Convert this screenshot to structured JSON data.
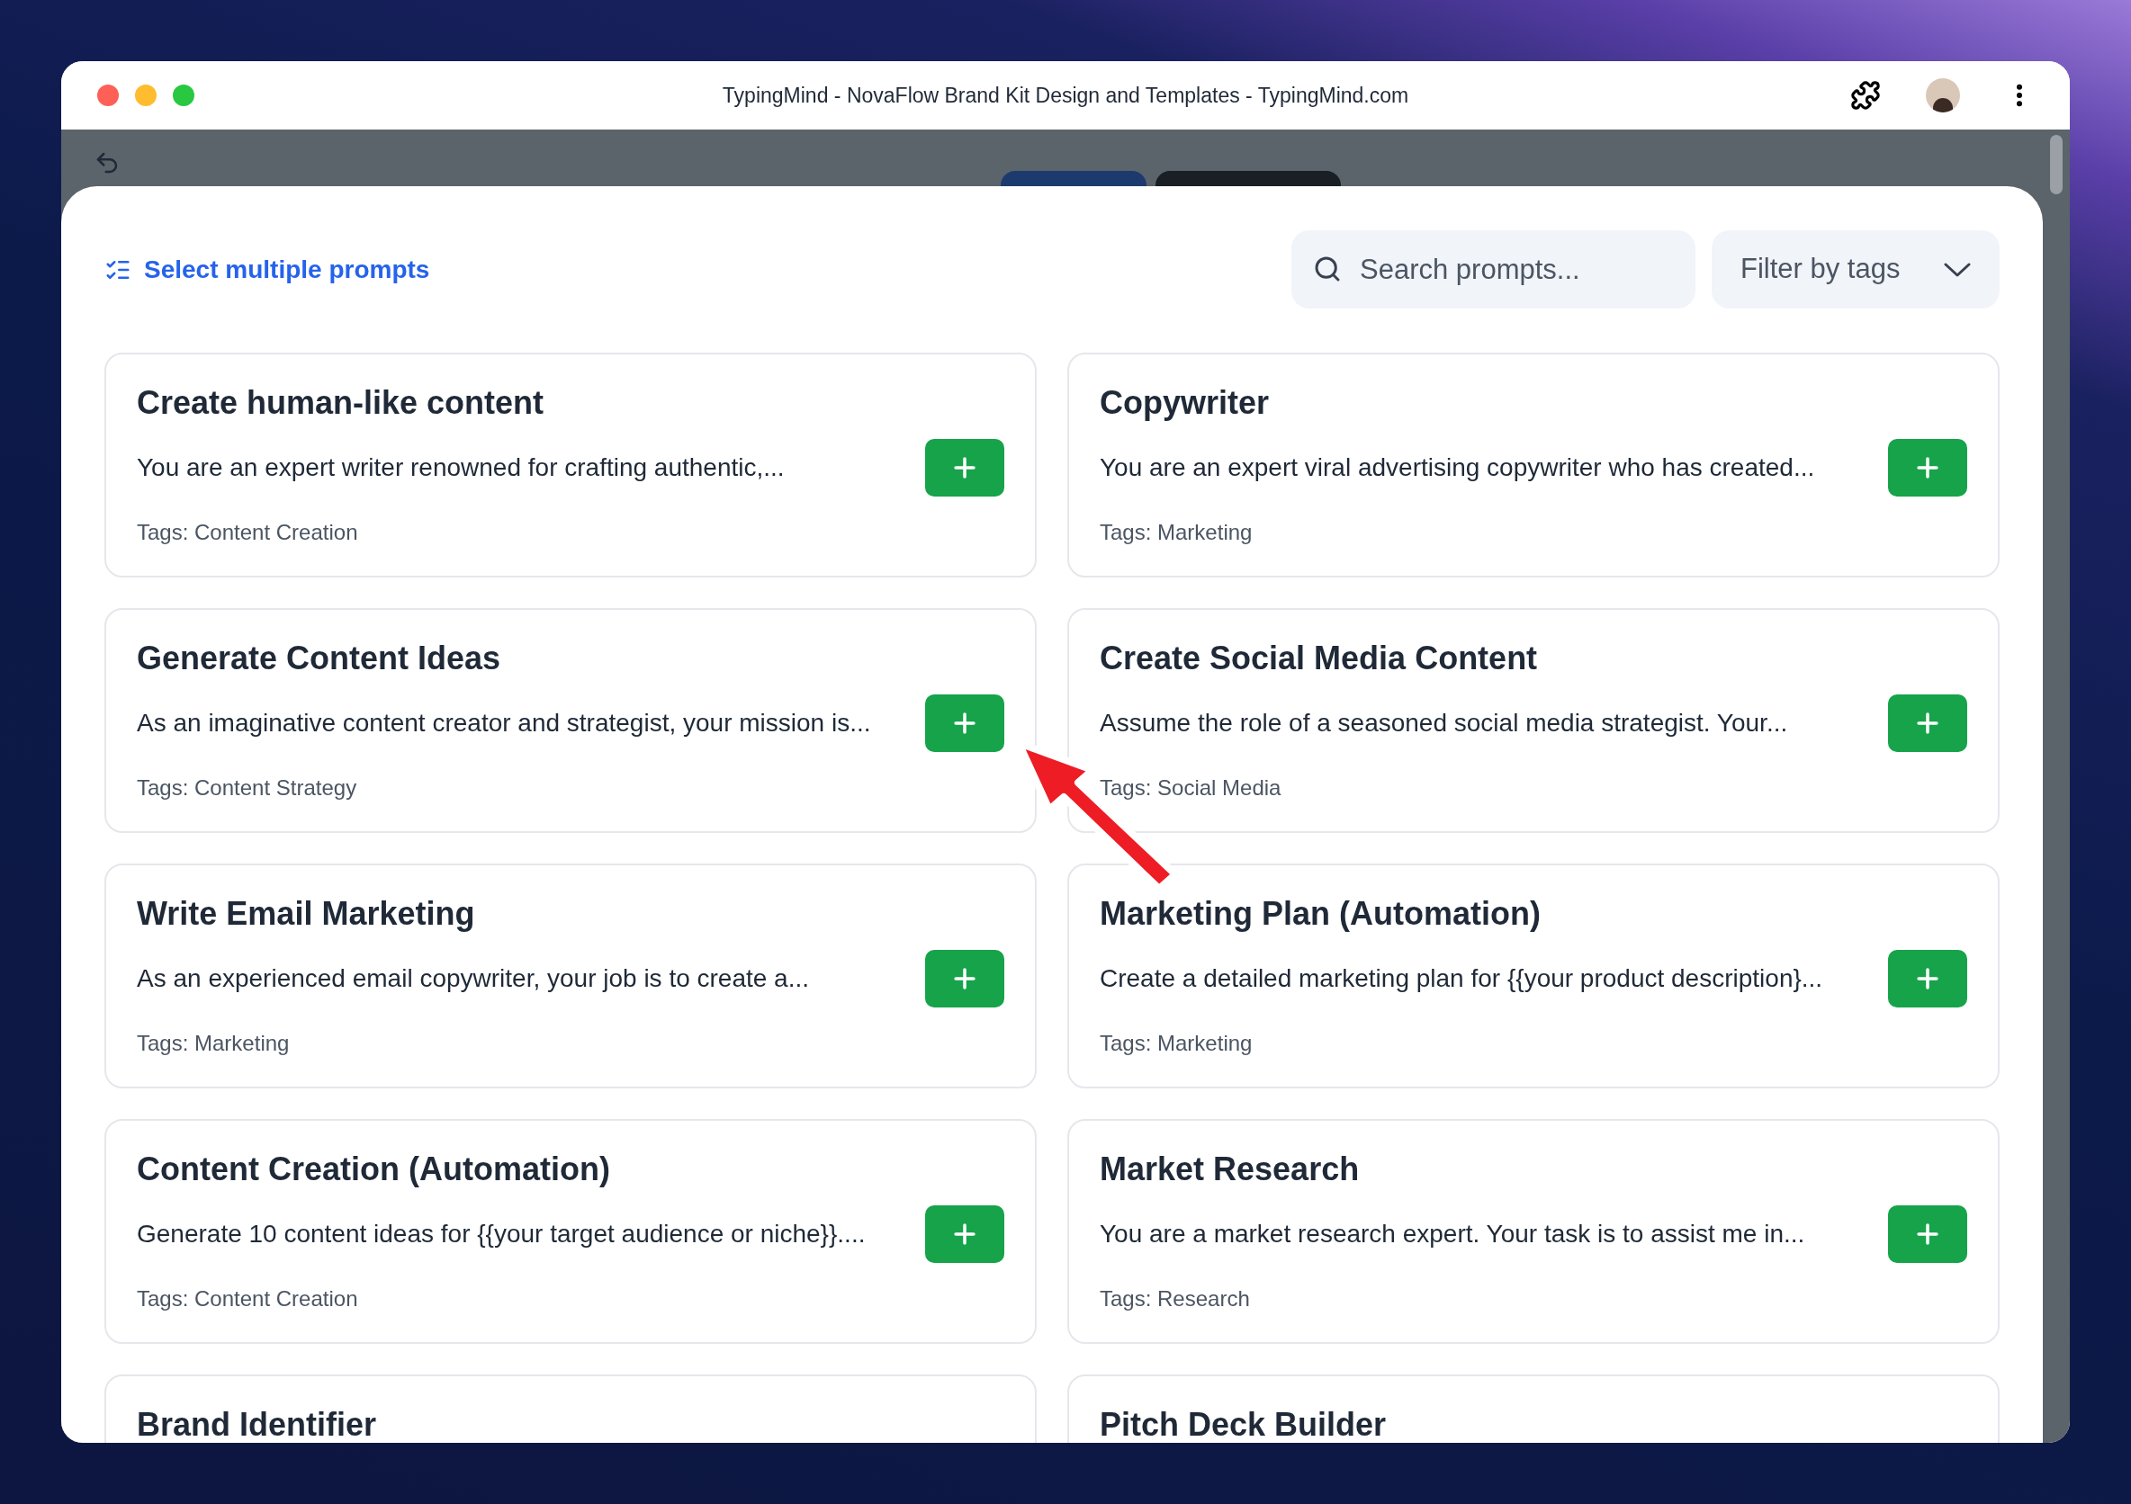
{
  "window": {
    "title": "TypingMind - NovaFlow Brand Kit Design and Templates - TypingMind.com"
  },
  "modal": {
    "select_link": "Select multiple prompts",
    "search": {
      "placeholder": "Search prompts..."
    },
    "filter": {
      "label": "Filter by tags"
    },
    "prompts": [
      {
        "title": "Create human-like content",
        "description": "You are an expert writer renowned for crafting authentic,...",
        "tags": "Tags: Content Creation"
      },
      {
        "title": "Copywriter",
        "description": "You are an expert viral advertising copywriter who has created...",
        "tags": "Tags: Marketing"
      },
      {
        "title": "Generate Content Ideas",
        "description": "As an imaginative content creator and strategist, your mission is...",
        "tags": "Tags: Content Strategy"
      },
      {
        "title": "Create Social Media Content",
        "description": "Assume the role of a seasoned social media strategist. Your...",
        "tags": "Tags: Social Media"
      },
      {
        "title": "Write Email Marketing",
        "description": "As an experienced email copywriter, your job is to create a...",
        "tags": "Tags: Marketing"
      },
      {
        "title": "Marketing Plan (Automation)",
        "description": "Create a detailed marketing plan for {{your product description}...",
        "tags": "Tags: Marketing"
      },
      {
        "title": "Content Creation (Automation)",
        "description": "Generate 10 content ideas for {{your target audience or niche}}....",
        "tags": "Tags: Content Creation"
      },
      {
        "title": "Market Research",
        "description": "You are a market research expert. Your task is to assist me in...",
        "tags": "Tags: Research"
      },
      {
        "title": "Brand Identifier"
      },
      {
        "title": "Pitch Deck Builder"
      }
    ]
  }
}
